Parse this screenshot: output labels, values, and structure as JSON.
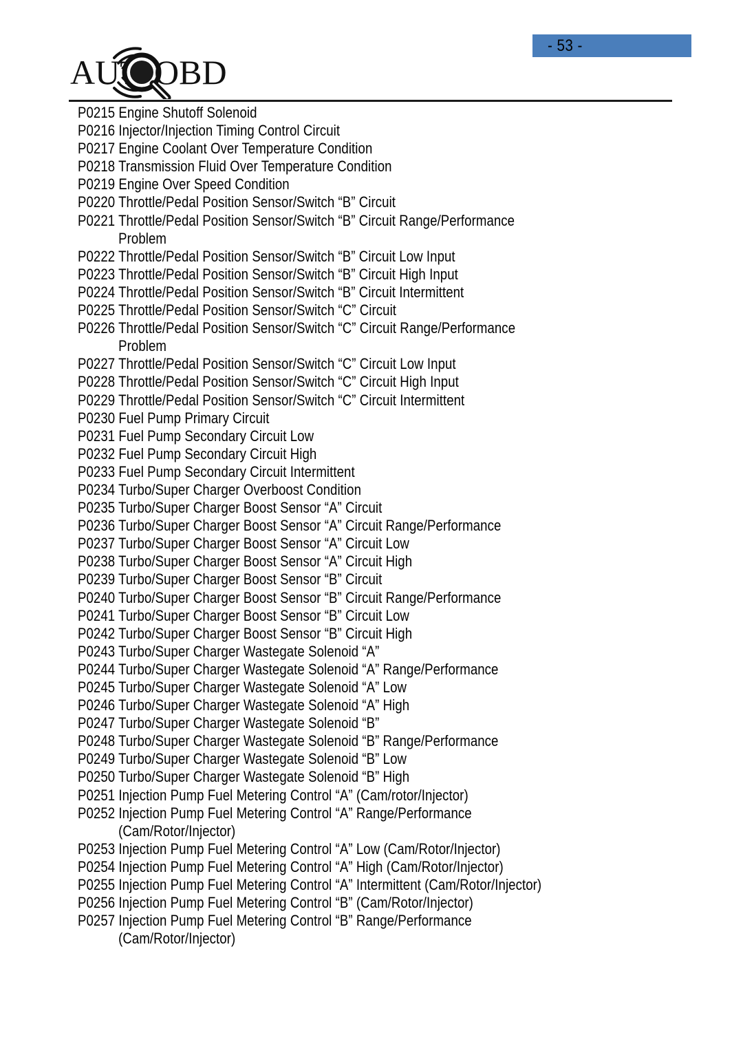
{
  "page": {
    "number_label": "- 53 -",
    "badge_color": "#4a7ebb"
  },
  "logo": {
    "text_left": "AUT",
    "text_right": "OBD",
    "full_name": "AUTOBD",
    "icon": "magnifying-glass-signal-icon"
  },
  "codes": [
    {
      "text": "P0215 Engine Shutoff Solenoid",
      "indent": false
    },
    {
      "text": "P0216 Injector/Injection Timing Control Circuit",
      "indent": false
    },
    {
      "text": "P0217 Engine Coolant Over Temperature Condition",
      "indent": false
    },
    {
      "text": "P0218 Transmission Fluid Over Temperature Condition",
      "indent": false
    },
    {
      "text": "P0219 Engine Over Speed Condition",
      "indent": false
    },
    {
      "text": "P0220 Throttle/Pedal Position Sensor/Switch “B” Circuit",
      "indent": false
    },
    {
      "text": "P0221 Throttle/Pedal Position Sensor/Switch “B” Circuit Range/Performance",
      "indent": false
    },
    {
      "text": "Problem",
      "indent": true
    },
    {
      "text": "P0222 Throttle/Pedal Position Sensor/Switch “B” Circuit Low Input",
      "indent": false
    },
    {
      "text": "P0223 Throttle/Pedal Position Sensor/Switch “B” Circuit High Input",
      "indent": false
    },
    {
      "text": "P0224 Throttle/Pedal Position Sensor/Switch “B” Circuit Intermittent",
      "indent": false
    },
    {
      "text": "P0225 Throttle/Pedal Position Sensor/Switch “C” Circuit",
      "indent": false
    },
    {
      "text": "P0226 Throttle/Pedal Position Sensor/Switch “C” Circuit Range/Performance",
      "indent": false
    },
    {
      "text": "Problem",
      "indent": true
    },
    {
      "text": "P0227 Throttle/Pedal Position Sensor/Switch “C” Circuit Low Input",
      "indent": false
    },
    {
      "text": "P0228 Throttle/Pedal Position Sensor/Switch “C” Circuit High Input",
      "indent": false
    },
    {
      "text": "P0229 Throttle/Pedal Position Sensor/Switch “C” Circuit Intermittent",
      "indent": false
    },
    {
      "text": "P0230 Fuel Pump Primary Circuit",
      "indent": false
    },
    {
      "text": "P0231 Fuel Pump Secondary Circuit Low",
      "indent": false
    },
    {
      "text": "P0232 Fuel Pump Secondary Circuit High",
      "indent": false
    },
    {
      "text": "P0233 Fuel Pump Secondary Circuit Intermittent",
      "indent": false
    },
    {
      "text": "P0234 Turbo/Super Charger Overboost Condition",
      "indent": false
    },
    {
      "text": "P0235 Turbo/Super Charger Boost Sensor “A” Circuit",
      "indent": false
    },
    {
      "text": "P0236 Turbo/Super Charger Boost Sensor “A” Circuit Range/Performance",
      "indent": false
    },
    {
      "text": "P0237 Turbo/Super Charger Boost Sensor “A” Circuit Low",
      "indent": false
    },
    {
      "text": "P0238 Turbo/Super Charger Boost Sensor “A” Circuit High",
      "indent": false
    },
    {
      "text": "P0239 Turbo/Super Charger Boost Sensor “B” Circuit",
      "indent": false
    },
    {
      "text": "P0240 Turbo/Super Charger Boost Sensor “B” Circuit Range/Performance",
      "indent": false
    },
    {
      "text": "P0241 Turbo/Super Charger Boost Sensor “B” Circuit Low",
      "indent": false
    },
    {
      "text": "P0242 Turbo/Super Charger Boost Sensor “B” Circuit High",
      "indent": false
    },
    {
      "text": "P0243 Turbo/Super Charger Wastegate Solenoid “A”",
      "indent": false
    },
    {
      "text": "P0244 Turbo/Super Charger Wastegate Solenoid “A” Range/Performance",
      "indent": false
    },
    {
      "text": "P0245 Turbo/Super Charger Wastegate Solenoid “A” Low",
      "indent": false
    },
    {
      "text": "P0246 Turbo/Super Charger Wastegate Solenoid “A” High",
      "indent": false
    },
    {
      "text": "P0247 Turbo/Super Charger Wastegate Solenoid “B”",
      "indent": false
    },
    {
      "text": "P0248 Turbo/Super Charger Wastegate Solenoid “B” Range/Performance",
      "indent": false
    },
    {
      "text": "P0249 Turbo/Super Charger Wastegate Solenoid “B” Low",
      "indent": false
    },
    {
      "text": "P0250 Turbo/Super Charger Wastegate Solenoid “B” High",
      "indent": false
    },
    {
      "text": "P0251 Injection Pump Fuel Metering Control “A” (Cam/rotor/Injector)",
      "indent": false
    },
    {
      "text": "P0252 Injection Pump Fuel Metering Control “A” Range/Performance",
      "indent": false
    },
    {
      "text": "(Cam/Rotor/Injector)",
      "indent": true
    },
    {
      "text": "P0253 Injection Pump Fuel Metering Control “A” Low (Cam/Rotor/Injector)",
      "indent": false
    },
    {
      "text": "P0254 Injection Pump Fuel Metering Control “A” High (Cam/Rotor/Injector)",
      "indent": false
    },
    {
      "text": "P0255 Injection Pump Fuel Metering Control “A” Intermittent (Cam/Rotor/Injector)",
      "indent": false
    },
    {
      "text": "P0256 Injection Pump Fuel Metering Control “B” (Cam/Rotor/Injector)",
      "indent": false
    },
    {
      "text": "P0257 Injection Pump Fuel Metering Control “B” Range/Performance",
      "indent": false
    },
    {
      "text": "(Cam/Rotor/Injector)",
      "indent": true
    }
  ]
}
